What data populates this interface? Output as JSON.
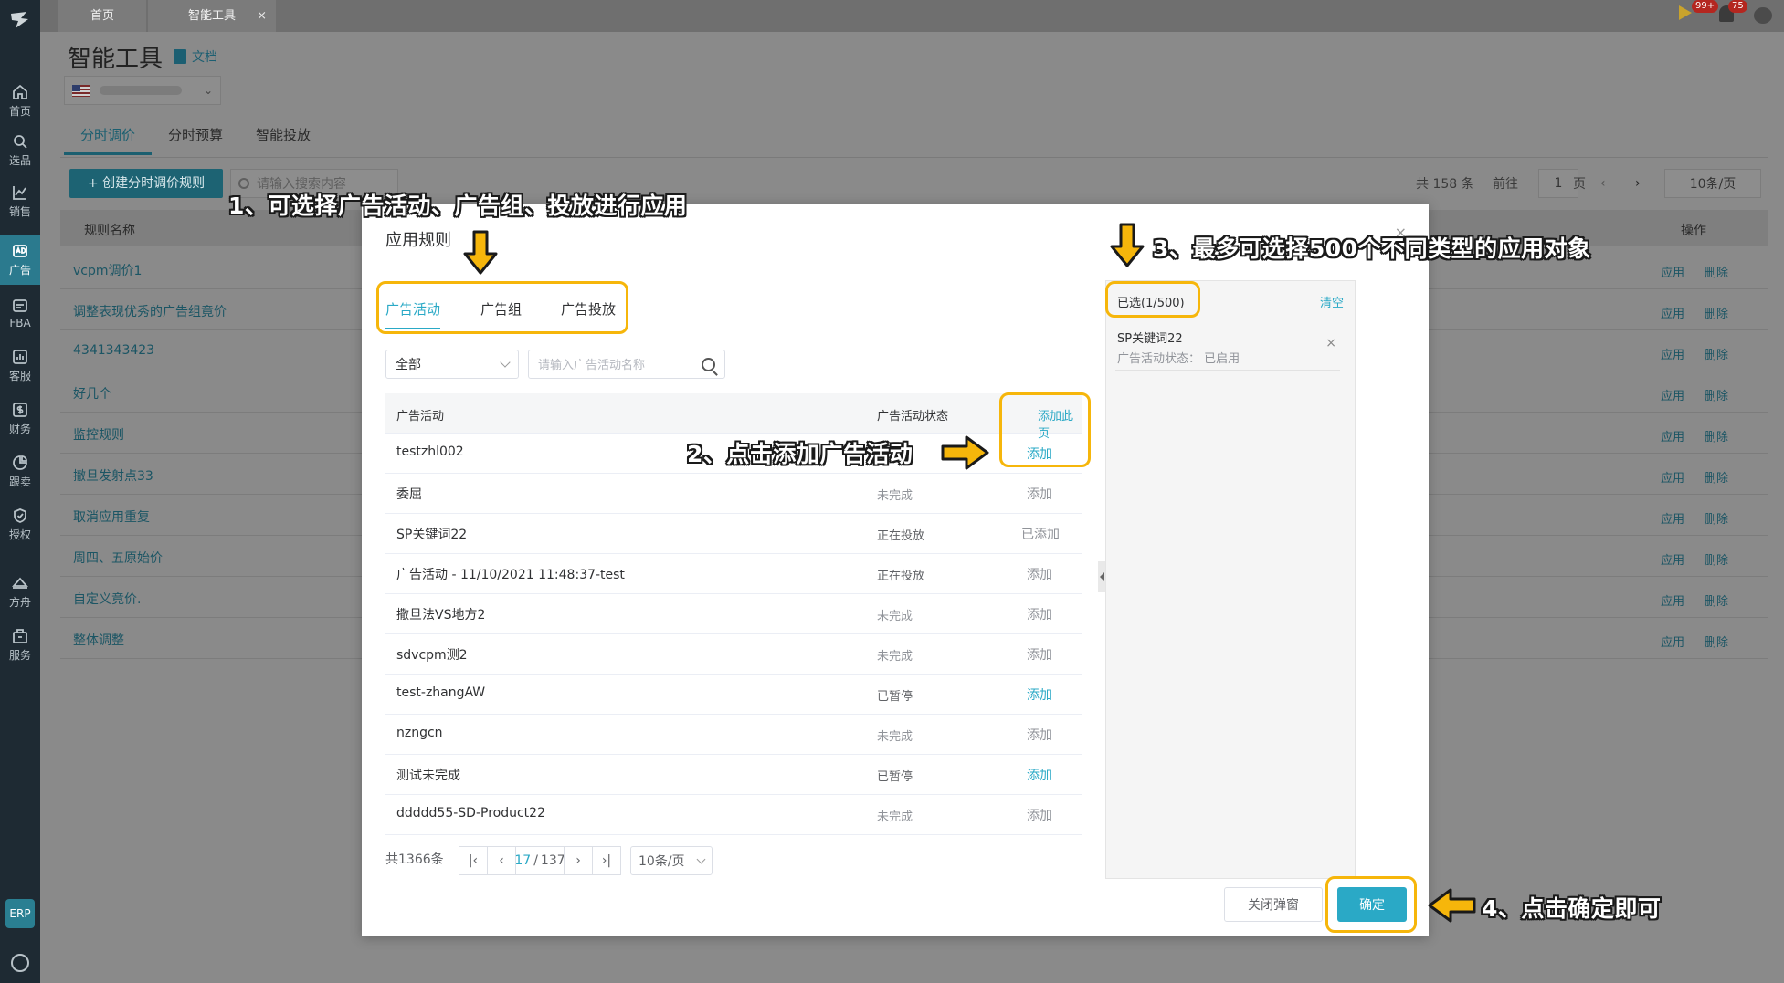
{
  "sidenav": {
    "items": [
      {
        "label": "首页",
        "icon": "home-icon"
      },
      {
        "label": "选品",
        "icon": "search-icon"
      },
      {
        "label": "销售",
        "icon": "chart-line-icon"
      },
      {
        "label": "广告",
        "icon": "ad-icon"
      },
      {
        "label": "FBA",
        "icon": "box-icon"
      },
      {
        "label": "客服",
        "icon": "message-icon"
      },
      {
        "label": "财务",
        "icon": "dollar-icon"
      },
      {
        "label": "跟卖",
        "icon": "pie-icon"
      },
      {
        "label": "授权",
        "icon": "shield-icon"
      },
      {
        "label": "方舟",
        "icon": "ark-icon"
      },
      {
        "label": "服务",
        "icon": "store-icon"
      }
    ],
    "erp": "ERP"
  },
  "topbar": {
    "tabs": [
      {
        "label": "首页"
      },
      {
        "label": "智能工具",
        "closable": "×"
      }
    ],
    "badge_msgs": "99+",
    "badge_bell": "75"
  },
  "page": {
    "title": "智能工具",
    "doc_label": "文档",
    "tabs": [
      {
        "label": "分时调价"
      },
      {
        "label": "分时预算"
      },
      {
        "label": "智能投放"
      }
    ],
    "create_button": "+ 创建分时调价规则",
    "search_placeholder": "请输入搜索内容",
    "total": "共 158 条",
    "goto_label": "前往",
    "goto_value": "1",
    "page_unit": "页",
    "page_size": "10条/页",
    "table_headers": {
      "name": "规则名称",
      "action": "操作"
    },
    "rules": [
      {
        "name": "vcpm调价1"
      },
      {
        "name": "调整表现优秀的广告组竟价"
      },
      {
        "name": "4341343423"
      },
      {
        "name": "好几个"
      },
      {
        "name": "监控规则"
      },
      {
        "name": "撤旦发射点33"
      },
      {
        "name": "取消应用重复"
      },
      {
        "name": "周四、五原始价"
      },
      {
        "name": "自定义竟价."
      },
      {
        "name": "整体调整"
      }
    ],
    "row_actions": {
      "apply": "应用",
      "delete": "删除"
    }
  },
  "modal": {
    "title": "应用规则",
    "close": "×",
    "tabs": [
      {
        "label": "广告活动"
      },
      {
        "label": "广告组"
      },
      {
        "label": "广告投放"
      }
    ],
    "filter_value": "全部",
    "search_placeholder": "请输入广告活动名称",
    "columns": {
      "name": "广告活动",
      "status": "广告活动状态",
      "add_page": "添加此页"
    },
    "rows": [
      {
        "name": "testzhl002",
        "status": "",
        "action": "添加"
      },
      {
        "name": "委屈",
        "status": "未完成",
        "action": "添加"
      },
      {
        "name": "SP关键词22",
        "status": "正在投放",
        "action": "已添加"
      },
      {
        "name": "广告活动 - 11/10/2021 11:48:37-test",
        "status": "正在投放",
        "action": "添加"
      },
      {
        "name": "撒旦法VS地方2",
        "status": "未完成",
        "action": "添加"
      },
      {
        "name": "sdvcpm测2",
        "status": "未完成",
        "action": "添加"
      },
      {
        "name": "test-zhangAW",
        "status": "已暂停",
        "action": "添加"
      },
      {
        "name": "nzngcn",
        "status": "未完成",
        "action": "添加"
      },
      {
        "name": "测试未完成",
        "status": "已暂停",
        "action": "添加"
      },
      {
        "name": "ddddd55-SD-Product22",
        "status": "未完成",
        "action": "添加"
      }
    ],
    "pager": {
      "total": "共1366条",
      "current": "17",
      "separator": "/",
      "pages": "137",
      "size": "10条/页"
    },
    "selected": {
      "count": "已选(1/500)",
      "clear": "清空",
      "items": [
        {
          "name": "SP关键词22",
          "status": "广告活动状态：  已启用"
        }
      ]
    },
    "buttons": {
      "close": "关闭弹窗",
      "ok": "确定"
    }
  },
  "annotations": {
    "step1": "1、可选择广告活动、广告组、投放进行应用",
    "step2": "2、点击添加广告活动",
    "step3": "3、最多可选择500个不同类型的应用对象",
    "step4": "4、点击确定即可"
  },
  "colors": {
    "accent": "#2aa9c6",
    "highlight": "#f6b60b",
    "nav_bg": "#1e2a33"
  }
}
